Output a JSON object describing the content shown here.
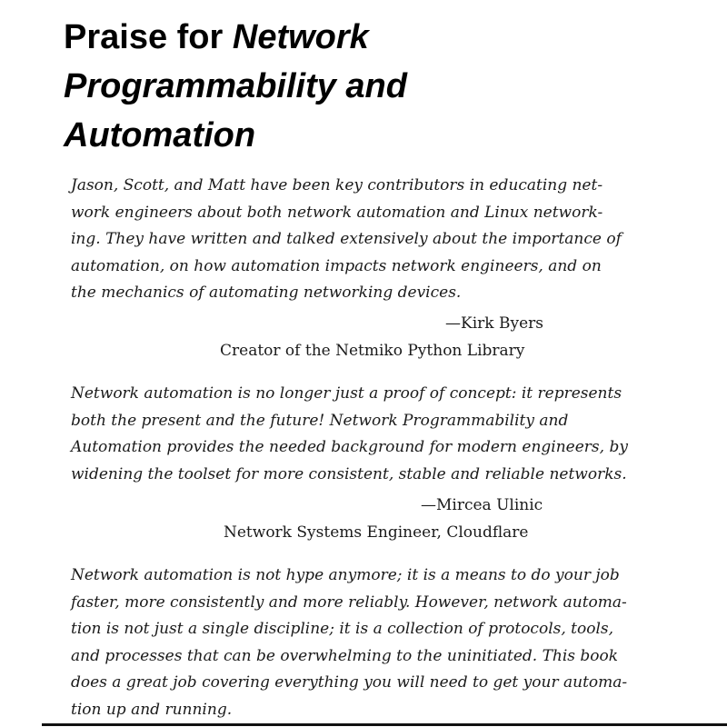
{
  "heading": {
    "prefix": "Praise for ",
    "title_italic_1": "Network",
    "title_italic_2": "Programmability and",
    "title_italic_3": "Automation"
  },
  "testimonials": [
    {
      "lines": [
        "Jason, Scott, and Matt have been key contributors in educating net-",
        "work engineers about both network automation and Linux network-",
        "ing. They have written and talked extensively about the importance of",
        "automation, on how automation impacts network engineers, and on",
        "the mechanics of automating networking devices."
      ],
      "name": "—Kirk Byers",
      "role": "Creator of the Netmiko Python Library"
    },
    {
      "lines": [
        "Network automation is no longer just a proof of concept: it represents",
        "both the present and the future! Network Programmability and",
        "Automation provides the needed background for modern engineers, by",
        "widening the toolset for more consistent, stable and reliable networks."
      ],
      "name": "—Mircea Ulinic",
      "role": "Network Systems Engineer, Cloudflare"
    },
    {
      "lines": [
        "Network automation is not hype anymore; it is a means to do your job",
        "faster, more consistently and more reliably. However, network automa-",
        "tion is not just a single discipline; it is a collection of protocols, tools,",
        "and processes that can be overwhelming to the uninitiated. This book",
        "does a great job covering everything you will need to get your automa-",
        "tion up and running."
      ]
    }
  ]
}
